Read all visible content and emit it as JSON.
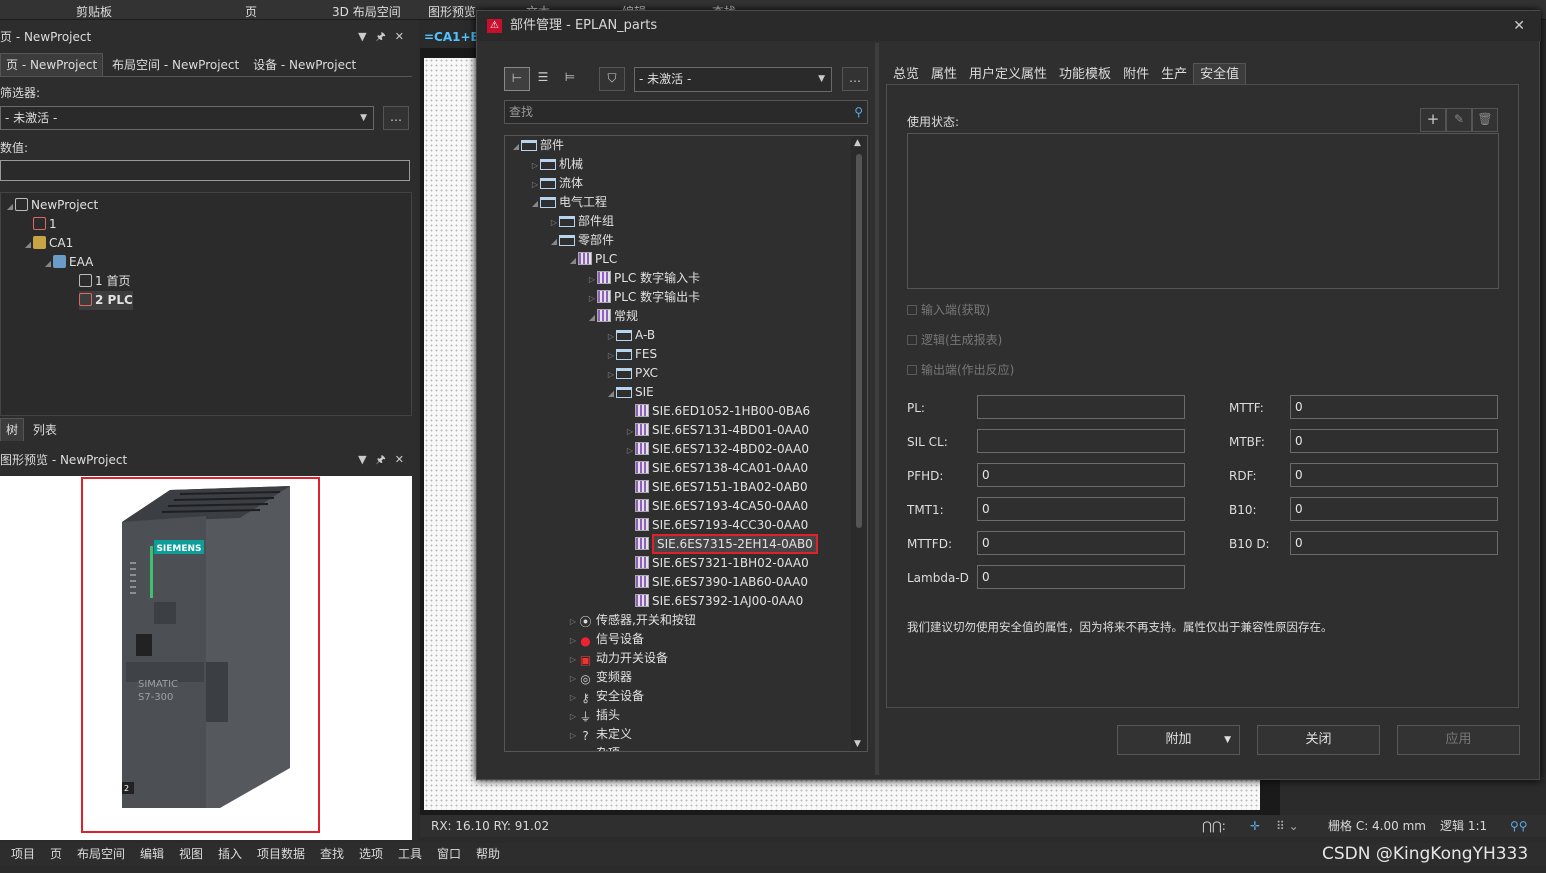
{
  "ribbon": {
    "items": [
      "剪贴板",
      "页",
      "3D 布局空间",
      "图形预览",
      "文本",
      "编辑",
      "查找"
    ]
  },
  "left": {
    "page_panel_title": "页 - NewProject",
    "tabs": [
      "页 - NewProject",
      "布局空间 - NewProject",
      "设备 - NewProject"
    ],
    "filter_label": "筛选器:",
    "filter_value": "- 未激活 -",
    "value_label": "数值:",
    "tree": [
      {
        "label": "NewProject",
        "icon": "project-icon"
      },
      {
        "label": "1",
        "icon": "page-icon"
      },
      {
        "label": "CA1",
        "icon": "structure-icon"
      },
      {
        "label": "EAA",
        "icon": "location-icon"
      },
      {
        "label": "1 首页",
        "icon": "page-icon"
      },
      {
        "label": "2 PLC",
        "icon": "page-icon"
      }
    ],
    "bottom_tabs": [
      "树",
      "列表"
    ],
    "preview_title": "图形预览 - NewProject",
    "preview_brand": "SIEMENS",
    "preview_model": "SIMATIC",
    "preview_series": "S7-300",
    "preview_slot": "2"
  },
  "canvas_tab": "=CA1+E",
  "status": {
    "coords": "RX: 16.10 RY: 91.02",
    "grid": "栅格 C: 4.00 mm",
    "logic": "逻辑 1:1"
  },
  "menu": [
    "项目",
    "页",
    "布局空间",
    "编辑",
    "视图",
    "插入",
    "项目数据",
    "查找",
    "选项",
    "工具",
    "窗口",
    "帮助"
  ],
  "watermark": "CSDN @KingKongYH333",
  "dialog": {
    "title": "部件管理 - EPLAN_parts",
    "filter_value": "- 未激活 -",
    "search_placeholder": "查找",
    "tree": [
      {
        "label": "部件",
        "lvl": 0,
        "icon": "folder",
        "exp": "◢"
      },
      {
        "label": "机械",
        "lvl": 1,
        "icon": "folder",
        "exp": "▷"
      },
      {
        "label": "流体",
        "lvl": 1,
        "icon": "folder",
        "exp": "▷"
      },
      {
        "label": "电气工程",
        "lvl": 1,
        "icon": "folder",
        "exp": "◢"
      },
      {
        "label": "部件组",
        "lvl": 2,
        "icon": "folder",
        "exp": "▷"
      },
      {
        "label": "零部件",
        "lvl": 2,
        "icon": "folder",
        "exp": "◢"
      },
      {
        "label": "PLC",
        "lvl": 3,
        "icon": "plc",
        "exp": "◢"
      },
      {
        "label": "PLC 数字输入卡",
        "lvl": 4,
        "icon": "plc",
        "exp": "▷"
      },
      {
        "label": "PLC 数字输出卡",
        "lvl": 4,
        "icon": "plc",
        "exp": "▷"
      },
      {
        "label": "常规",
        "lvl": 4,
        "icon": "plc",
        "exp": "◢"
      },
      {
        "label": "A-B",
        "lvl": 5,
        "icon": "folder",
        "exp": "▷"
      },
      {
        "label": "FES",
        "lvl": 5,
        "icon": "folder",
        "exp": "▷"
      },
      {
        "label": "PXC",
        "lvl": 5,
        "icon": "folder",
        "exp": "▷"
      },
      {
        "label": "SIE",
        "lvl": 5,
        "icon": "folder",
        "exp": "◢"
      },
      {
        "label": "SIE.6ED1052-1HB00-0BA6",
        "lvl": 6,
        "icon": "plc",
        "exp": ""
      },
      {
        "label": "SIE.6ES7131-4BD01-0AA0",
        "lvl": 6,
        "icon": "plc",
        "exp": "▷"
      },
      {
        "label": "SIE.6ES7132-4BD02-0AA0",
        "lvl": 6,
        "icon": "plc",
        "exp": "▷"
      },
      {
        "label": "SIE.6ES7138-4CA01-0AA0",
        "lvl": 6,
        "icon": "plc",
        "exp": ""
      },
      {
        "label": "SIE.6ES7151-1BA02-0AB0",
        "lvl": 6,
        "icon": "plc",
        "exp": ""
      },
      {
        "label": "SIE.6ES7193-4CA50-0AA0",
        "lvl": 6,
        "icon": "plc",
        "exp": ""
      },
      {
        "label": "SIE.6ES7193-4CC30-0AA0",
        "lvl": 6,
        "icon": "plc",
        "exp": ""
      },
      {
        "label": "SIE.6ES7315-2EH14-0AB0",
        "lvl": 6,
        "icon": "plc",
        "exp": "",
        "selected": true
      },
      {
        "label": "SIE.6ES7321-1BH02-0AA0",
        "lvl": 6,
        "icon": "plc",
        "exp": ""
      },
      {
        "label": "SIE.6ES7390-1AB60-0AA0",
        "lvl": 6,
        "icon": "plc",
        "exp": ""
      },
      {
        "label": "SIE.6ES7392-1AJ00-0AA0",
        "lvl": 6,
        "icon": "plc",
        "exp": ""
      },
      {
        "label": "传感器,开关和按钮",
        "lvl": 3,
        "icon": "sensor",
        "exp": "▷"
      },
      {
        "label": "信号设备",
        "lvl": 3,
        "icon": "signal",
        "exp": "▷"
      },
      {
        "label": "动力开关设备",
        "lvl": 3,
        "icon": "power",
        "exp": "▷"
      },
      {
        "label": "变频器",
        "lvl": 3,
        "icon": "vfd",
        "exp": "▷"
      },
      {
        "label": "安全设备",
        "lvl": 3,
        "icon": "safety",
        "exp": "▷"
      },
      {
        "label": "插头",
        "lvl": 3,
        "icon": "plug",
        "exp": "▷"
      },
      {
        "label": "未定义",
        "lvl": 3,
        "icon": "undefined",
        "exp": "▷"
      },
      {
        "label": "杂项",
        "lvl": 3,
        "icon": "misc",
        "exp": "▷"
      }
    ],
    "tabs": [
      "总览",
      "属性",
      "用户定义属性",
      "功能模板",
      "附件",
      "生产",
      "安全值"
    ],
    "usage_label": "使用状态:",
    "checkboxes": [
      "输入端(获取)",
      "逻辑(生成报表)",
      "输出端(作出反应)"
    ],
    "left_fields": [
      {
        "label": "PL:",
        "value": ""
      },
      {
        "label": "SIL CL:",
        "value": ""
      },
      {
        "label": "PFHD:",
        "value": "0"
      },
      {
        "label": "TMT1:",
        "value": "0"
      },
      {
        "label": "MTTFD:",
        "value": "0"
      },
      {
        "label": "Lambda-D",
        "value": "0"
      }
    ],
    "right_fields": [
      {
        "label": "MTTF:",
        "value": "0"
      },
      {
        "label": "MTBF:",
        "value": "0"
      },
      {
        "label": "RDF:",
        "value": "0"
      },
      {
        "label": "B10:",
        "value": "0"
      },
      {
        "label": "B10 D:",
        "value": "0"
      }
    ],
    "note": "我们建议切勿使用安全值的属性，因为将来不再支持。属性仅出于兼容性原因存在。",
    "buttons": {
      "extra": "附加",
      "close": "关闭",
      "apply": "应用"
    }
  }
}
